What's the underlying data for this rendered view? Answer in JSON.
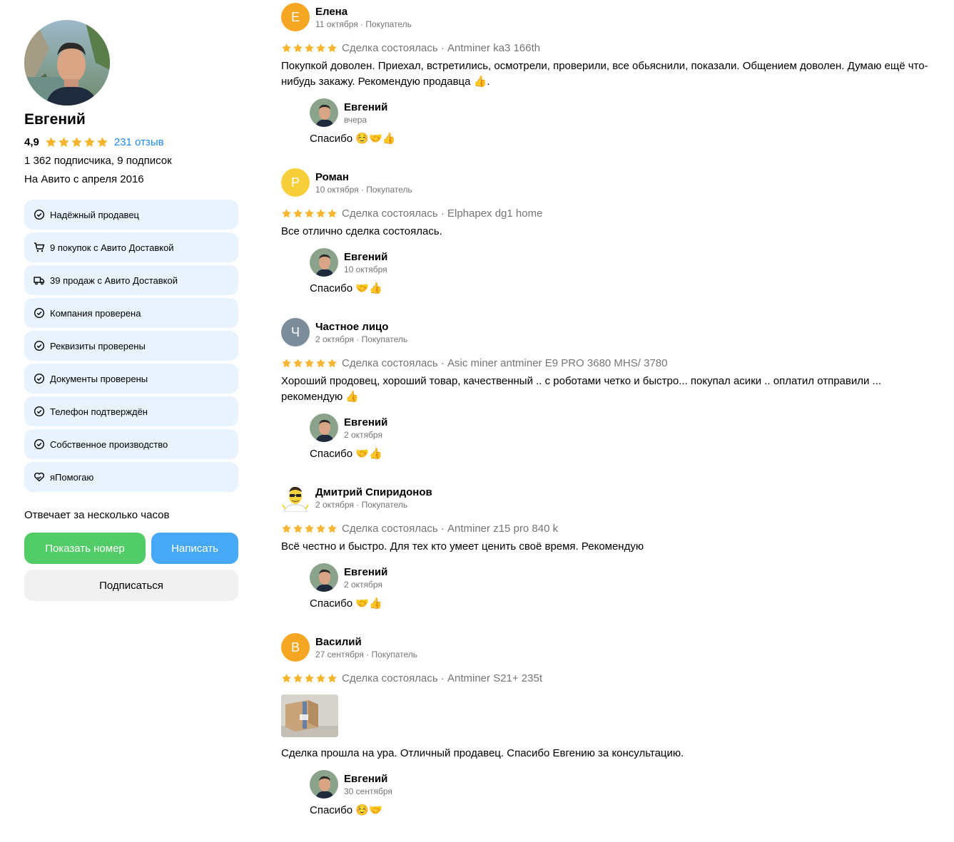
{
  "seller": {
    "name": "Евгений",
    "rating": "4,9",
    "reviews_link": "231 отзыв",
    "subscribers": "1 362 подписчика, 9 подписок",
    "since": "На Авито с апреля 2016",
    "response_time": "Отвечает за несколько часов"
  },
  "badges": [
    {
      "label": "Надёжный продавец",
      "icon": "check-circle-icon"
    },
    {
      "label": "9 покупок с Авито Доставкой",
      "icon": "cart-icon"
    },
    {
      "label": "39 продаж с Авито Доставкой",
      "icon": "truck-icon"
    },
    {
      "label": "Компания проверена",
      "icon": "check-circle-icon"
    },
    {
      "label": "Реквизиты проверены",
      "icon": "check-circle-icon"
    },
    {
      "label": "Документы проверены",
      "icon": "check-circle-icon"
    },
    {
      "label": "Телефон подтверждён",
      "icon": "check-circle-icon"
    },
    {
      "label": "Собственное производство",
      "icon": "check-circle-icon"
    },
    {
      "label": "яПомогаю",
      "icon": "heart-hands-icon"
    }
  ],
  "actions": {
    "show_phone": "Показать номер",
    "write": "Написать",
    "subscribe": "Подписаться"
  },
  "colors": {
    "star": "#f5b52e",
    "link": "#1e8cf0",
    "badge_bg": "#e8f3fd",
    "green": "#52cc67",
    "blue": "#47a8f5"
  },
  "reviews": [
    {
      "author": "Елена",
      "avatar_letter": "Е",
      "avatar_color": "#f5a623",
      "meta": "11 октября · Покупатель",
      "deal": "Сделка состоялась · Antminer ka3 166th",
      "text": "Покупкой доволен. Приехал, встретились, осмотрели, проверили, все обьяснили, показали. Общением доволен. Думаю ещё что-нибудь закажу. Рекомендую продавца 👍.",
      "reply": {
        "author": "Евгений",
        "date": "вчера",
        "text": "Спасибо ☺️🤝👍"
      }
    },
    {
      "author": "Роман",
      "avatar_letter": "Р",
      "avatar_color": "#f7cf3b",
      "meta": "10 октября · Покупатель",
      "deal": "Сделка состоялась · Elphapex dg1 home",
      "text": "Все отлично сделка состоялась.",
      "reply": {
        "author": "Евгений",
        "date": "10 октября",
        "text": "Спасибо 🤝👍"
      }
    },
    {
      "author": "Частное лицо",
      "avatar_letter": "Ч",
      "avatar_color": "#7d8c9a",
      "meta": "2 октября · Покупатель",
      "deal": "Сделка состоялась · Asic miner antminer E9 PRO 3680 MHS/ 3780",
      "text": "Хороший продовец, хороший товар, качественный .. с роботами четко и быстро... покупал асики .. оплатил отправили ... рекомендую 👍",
      "reply": {
        "author": "Евгений",
        "date": "2 октября",
        "text": "Спасибо 🤝👍"
      }
    },
    {
      "author": "Дмитрий Спиридонов",
      "avatar_letter": "",
      "avatar_color": "#ffffff",
      "meta": "2 октября · Покупатель",
      "deal": "Сделка состоялась · Antminer z15 pro 840 k",
      "text": "Всё честно и быстро. Для тех кто умеет ценить своё время. Рекомендую",
      "reply": {
        "author": "Евгений",
        "date": "2 октября",
        "text": "Спасибо 🤝👍"
      }
    },
    {
      "author": "Василий",
      "avatar_letter": "В",
      "avatar_color": "#f5a623",
      "meta": "27 сентября · Покупатель",
      "deal": "Сделка состоялась · Antminer S21+ 235t",
      "text": "Сделка прошла на ура. Отличный продавец. Спасибо Евгению за консультацию.",
      "reply": {
        "author": "Евгений",
        "date": "30 сентября",
        "text": "Спасибо ☺️🤝"
      }
    }
  ]
}
